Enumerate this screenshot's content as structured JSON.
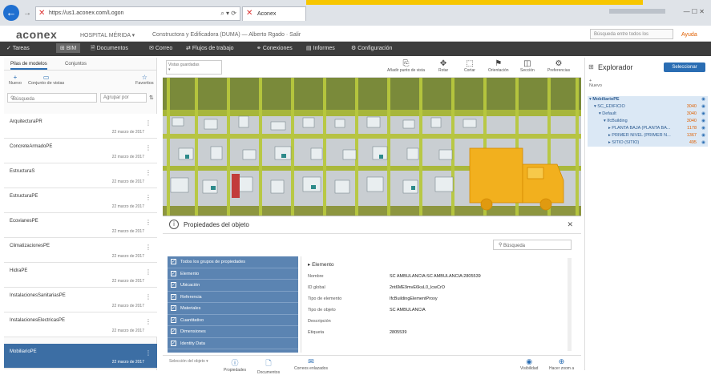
{
  "browser": {
    "url": "https://us1.aconex.com/Logon",
    "tab_title": "Aconex",
    "back_icon": "back-arrow-icon",
    "window_controls": "— ☐ ✕"
  },
  "header": {
    "logo": "aconex",
    "project": "HOSPITAL MÉRIDA",
    "organization": "Constructora y Edificadora (DUMA) — Alberto Rgado · Salir",
    "search_placeholder": "Búsqueda entre todos los",
    "help": "Ayuda"
  },
  "nav": {
    "items": [
      "Tareas",
      "BIM",
      "Documentos",
      "Correo",
      "Flujos de trabajo",
      "Conexiones",
      "Informes",
      "Configuración"
    ],
    "active_index": 1
  },
  "left_panel": {
    "tabs": [
      "Pilas de modelos",
      "Conjuntos"
    ],
    "tools": [
      "Nuevo",
      "Conjunto de vistas",
      "Favoritos"
    ],
    "search_placeholder": "Búsqueda",
    "group_placeholder": "Agrupar por",
    "items": [
      {
        "name": "ArquitecturaPR",
        "date": "22 marzo de 2017"
      },
      {
        "name": "ConcreteArmadoPE",
        "date": "22 marzo de 2017"
      },
      {
        "name": "EstructuraS",
        "date": "22 marzo de 2017"
      },
      {
        "name": "EstructuraPE",
        "date": "22 marzo de 2017"
      },
      {
        "name": "EcovianesPE",
        "date": "22 marzo de 2017"
      },
      {
        "name": "ClimatizacionesPE",
        "date": "22 marzo de 2017"
      },
      {
        "name": "HidraPE",
        "date": "22 marzo de 2017"
      },
      {
        "name": "InstalacionesSanitariasPE",
        "date": "22 marzo de 2017"
      },
      {
        "name": "InstalacionesElectricasPE",
        "date": "22 marzo de 2017"
      },
      {
        "name": "MobiliarioPE",
        "date": "22 marzo de 2017"
      }
    ],
    "selected_index": 9
  },
  "viewer": {
    "view_select": "Vistas guardadas",
    "toolbar": [
      "Añadir punto de vista",
      "Rotar",
      "Cortar",
      "Orientación",
      "Sección",
      "Preferencias"
    ]
  },
  "properties": {
    "title": "Propiedades del objeto",
    "search_placeholder": "Búsqueda",
    "categories": [
      "Todos los grupos de propiedades",
      "Elemento",
      "Ubicación",
      "Referencia",
      "Materiales",
      "Cuantitativo",
      "Dimensiones",
      "Identity Data"
    ],
    "detail_header": "Elemento",
    "fields": [
      {
        "key": "Nombre",
        "value": "SC AMBULANCIA:SC AMBULANCIA:2805539"
      },
      {
        "key": "ID global",
        "value": "2nt6ME9mvE6kuL0_lcwCrO"
      },
      {
        "key": "Tipo de elemento",
        "value": "IfcBuildingElementProxy"
      },
      {
        "key": "Tipo de objeto",
        "value": "SC AMBULANCIA"
      },
      {
        "key": "Descripción",
        "value": ""
      },
      {
        "key": "Etiqueta",
        "value": "2805539"
      }
    ],
    "bottom_left": "Selección del objeto",
    "bottom_buttons": [
      "Propiedades",
      "Documentos",
      "Correos enlazados"
    ],
    "bottom_right": [
      "Visibilidad",
      "Hacer zoom a"
    ]
  },
  "explorer": {
    "title": "Explorador",
    "button": "Seleccionar",
    "tools": "Nuevo",
    "tree": [
      {
        "label": "MobiliarioPE",
        "count": "",
        "depth": 0
      },
      {
        "label": "SC_EDIFICIO",
        "count": "3040",
        "depth": 1
      },
      {
        "label": "Default",
        "count": "3040",
        "depth": 2
      },
      {
        "label": "IfcBuilding",
        "count": "3040",
        "depth": 3
      },
      {
        "label": "PLANTA BAJA (PLANTA BA...",
        "count": "1178",
        "depth": 4
      },
      {
        "label": "PRIMER NIVEL (PRIMER N...",
        "count": "1367",
        "depth": 4
      },
      {
        "label": "SITIO (SITIO)",
        "count": "495",
        "depth": 4
      }
    ]
  }
}
